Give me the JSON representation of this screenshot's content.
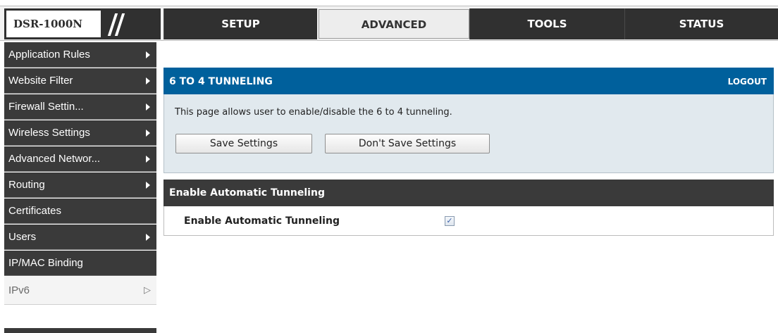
{
  "brand": {
    "model": "DSR-1000N"
  },
  "tabs": [
    {
      "label": "SETUP"
    },
    {
      "label": "ADVANCED"
    },
    {
      "label": "TOOLS"
    },
    {
      "label": "STATUS"
    }
  ],
  "active_tab": "ADVANCED",
  "sidebar": {
    "items": [
      {
        "label": "Application Rules",
        "has_arrow": true
      },
      {
        "label": "Website Filter",
        "has_arrow": true
      },
      {
        "label": "Firewall Settin...",
        "has_arrow": true
      },
      {
        "label": "Wireless Settings",
        "has_arrow": true
      },
      {
        "label": "Advanced Networ...",
        "has_arrow": true
      },
      {
        "label": "Routing",
        "has_arrow": true
      },
      {
        "label": "Certificates",
        "has_arrow": false
      },
      {
        "label": "Users",
        "has_arrow": true
      },
      {
        "label": "IP/MAC Binding",
        "has_arrow": false
      },
      {
        "label": "IPv6",
        "has_arrow": true,
        "selected": true
      }
    ]
  },
  "panel": {
    "title": "6 TO 4 TUNNELING",
    "logout": "LOGOUT",
    "description": "This page allows user to enable/disable the 6 to 4 tunneling.",
    "save_label": "Save Settings",
    "dont_save_label": "Don't Save Settings"
  },
  "section": {
    "title": "Enable Automatic Tunneling",
    "field_label": "Enable Automatic Tunneling",
    "checked": true,
    "check_mark": "✓"
  },
  "colors": {
    "header_blue": "#00609c",
    "dark_gray": "#3a3a3a",
    "panel_bg": "#e1e9ee"
  },
  "icons": {
    "sidebar_arrow": "triangle-right-icon",
    "selected_arrow": "triangle-right-outline-icon",
    "checkbox": "checkbox-checked-icon"
  }
}
